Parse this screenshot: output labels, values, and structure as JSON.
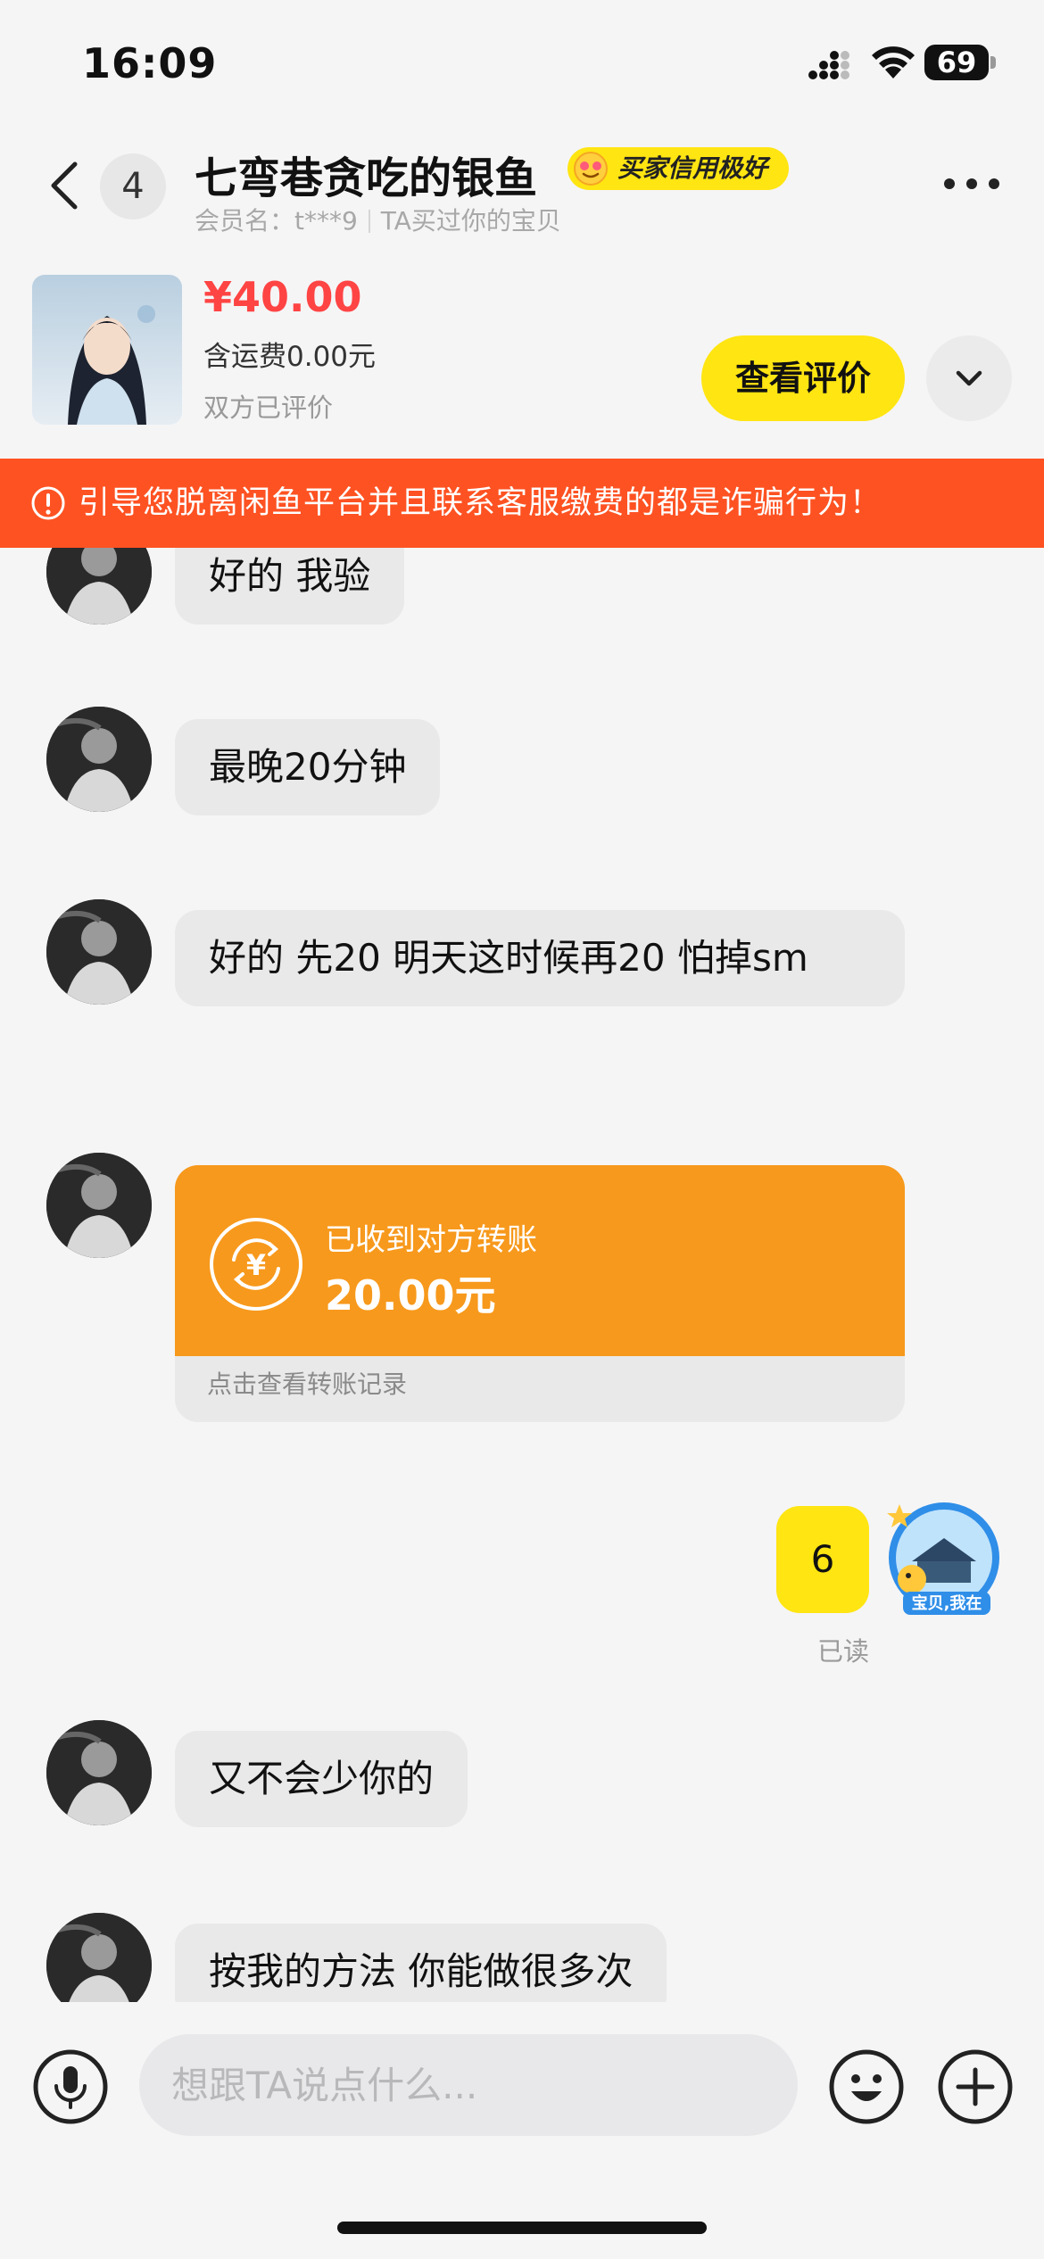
{
  "status_bar": {
    "time": "16:09",
    "battery": "69"
  },
  "header": {
    "unread_count": "4",
    "title": "七弯巷贪吃的银鱼",
    "credit_badge": "买家信用极好",
    "member_label": "会员名：t***9",
    "relation": "TA买过你的宝贝"
  },
  "product": {
    "price": "¥40.00",
    "shipping": "含运费0.00元",
    "review_status": "双方已评价",
    "view_review_label": "查看评价"
  },
  "warning": {
    "text": "引导您脱离闲鱼平台并且联系客服缴费的都是诈骗行为！"
  },
  "messages": [
    {
      "text": "好的 我验"
    },
    {
      "text": "最晚20分钟"
    },
    {
      "text": "好的 先20 明天这时候再20 怕掉sm"
    },
    {
      "transfer_title": "已收到对方转账",
      "transfer_amount": "20.00元",
      "transfer_link": "点击查看转账记录"
    },
    {
      "text": "6",
      "read": "已读",
      "avatar_caption": "宝贝,我在"
    },
    {
      "text": "又不会少你的"
    },
    {
      "text": "按我的方法 你能做很多次"
    }
  ],
  "input": {
    "placeholder": "想跟TA说点什么..."
  },
  "colors": {
    "accent_yellow": "#ffe512",
    "warning_red": "#fe5222",
    "transfer_orange": "#f7991c",
    "price_red": "#ff4444"
  }
}
